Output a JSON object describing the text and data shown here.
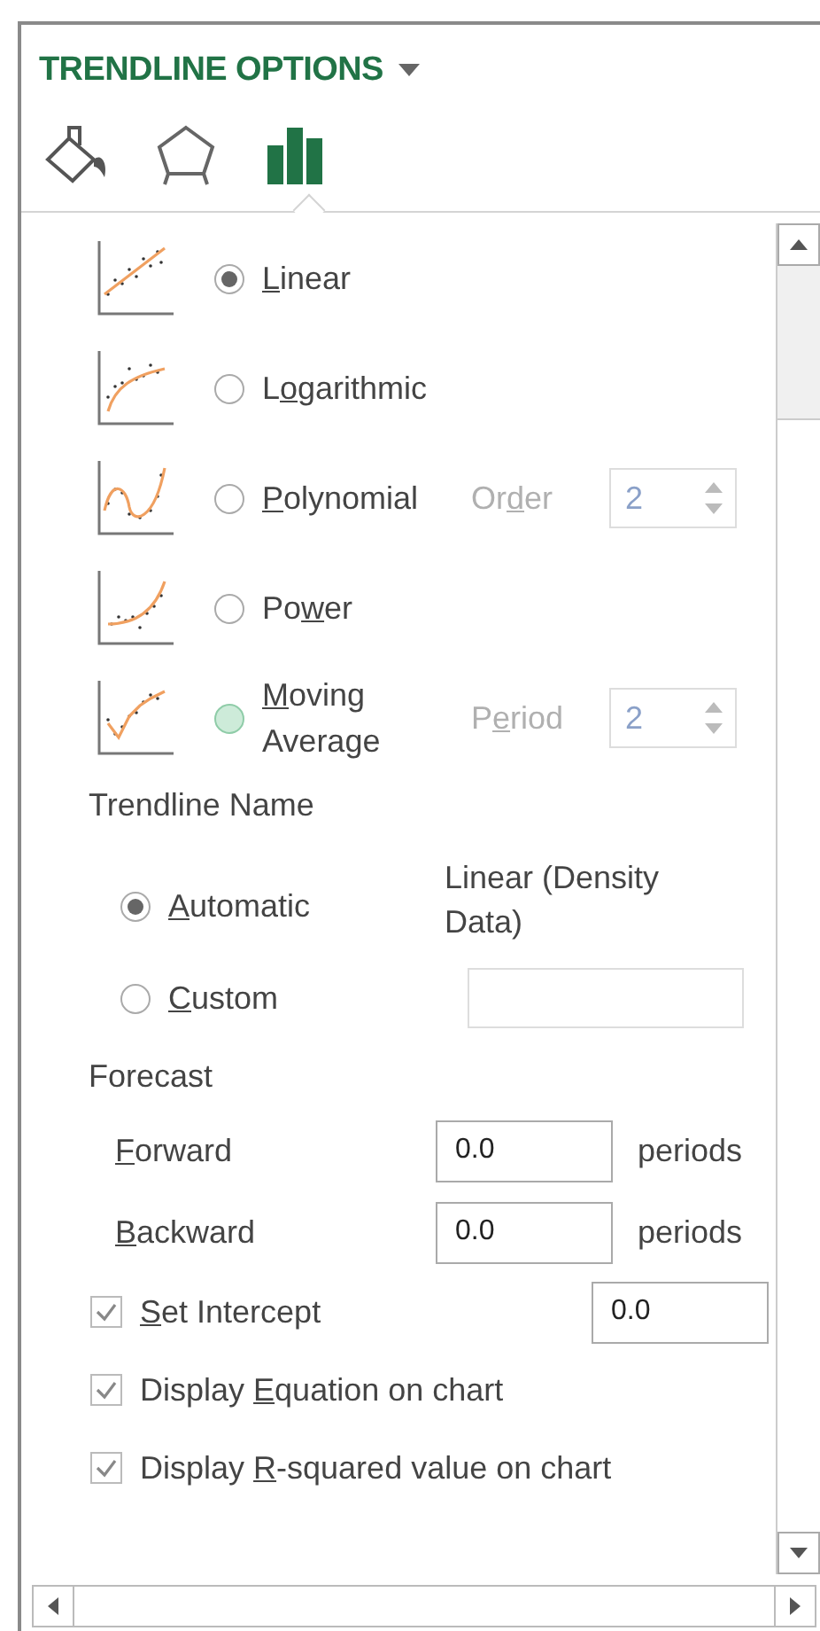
{
  "panel": {
    "title": "TRENDLINE OPTIONS",
    "tabs": [
      {
        "kind": "fill",
        "selected": false
      },
      {
        "kind": "effects",
        "selected": false
      },
      {
        "kind": "options",
        "selected": true
      }
    ]
  },
  "trend_types": [
    {
      "kind": "linear",
      "label": {
        "key": "L",
        "after": "inear"
      },
      "selected": true,
      "hovered": false
    },
    {
      "kind": "logarithmic",
      "label": {
        "before": "L",
        "key": "o",
        "after": "garithmic"
      },
      "selected": false,
      "hovered": false
    },
    {
      "kind": "polynomial",
      "label": {
        "key": "P",
        "after": "olynomial"
      },
      "selected": false,
      "hovered": false,
      "option": {
        "label": {
          "before": "Or",
          "key": "d",
          "after": "er"
        },
        "value": "2",
        "disabled": true
      }
    },
    {
      "kind": "power",
      "label": {
        "before": "Po",
        "key": "w",
        "after": "er"
      },
      "selected": false,
      "hovered": false
    },
    {
      "kind": "moving_average",
      "label": {
        "key": "M",
        "after": "oving Average"
      },
      "selected": false,
      "hovered": true,
      "option": {
        "label": {
          "before": "P",
          "key": "e",
          "after": "riod"
        },
        "value": "2",
        "disabled": true
      }
    }
  ],
  "trendline_name": {
    "heading": "Trendline Name",
    "options": [
      {
        "kind": "automatic",
        "label": {
          "key": "A",
          "after": "utomatic"
        },
        "selected": true,
        "value": "Linear (Density Data)"
      },
      {
        "kind": "custom",
        "label": {
          "key": "C",
          "after": "ustom"
        },
        "selected": false
      }
    ]
  },
  "forecast": {
    "heading": "Forecast",
    "rows": [
      {
        "label": {
          "key": "F",
          "after": "orward"
        },
        "value": "0.0",
        "unit": "periods"
      },
      {
        "label": {
          "key": "B",
          "after": "ackward"
        },
        "value": "0.0",
        "unit": "periods"
      }
    ]
  },
  "checks": [
    {
      "label": {
        "key": "S",
        "after": "et Intercept"
      },
      "checked": true,
      "value": "0.0"
    },
    {
      "label": {
        "before": "Display ",
        "key": "E",
        "after": "quation on chart"
      },
      "checked": true
    },
    {
      "label": {
        "before": "Display ",
        "key": "R",
        "after": "-squared value on chart"
      },
      "checked": true
    }
  ]
}
